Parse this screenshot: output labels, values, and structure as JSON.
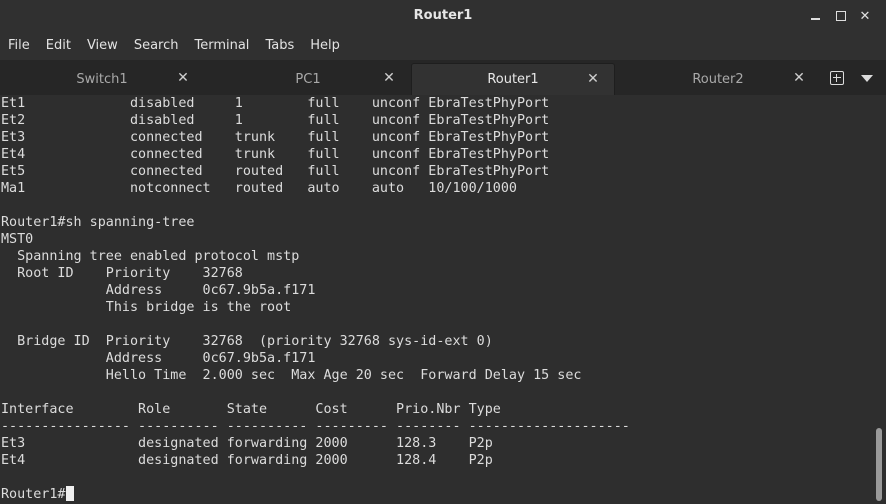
{
  "window": {
    "title": "Router1",
    "minimize_glyph": "–",
    "close_glyph": "✕"
  },
  "menu": {
    "items": [
      {
        "label": "File"
      },
      {
        "label": "Edit"
      },
      {
        "label": "View"
      },
      {
        "label": "Search"
      },
      {
        "label": "Terminal"
      },
      {
        "label": "Tabs"
      },
      {
        "label": "Help"
      }
    ]
  },
  "tabs": [
    {
      "label": "Switch1",
      "active": false
    },
    {
      "label": "PC1",
      "active": false
    },
    {
      "label": "Router1",
      "active": true
    },
    {
      "label": "Router2",
      "active": false
    }
  ],
  "tab_close_glyph": "✕",
  "terminal": {
    "lines": [
      "Et1             disabled     1        full    unconf EbraTestPhyPort",
      "Et2             disabled     1        full    unconf EbraTestPhyPort",
      "Et3             connected    trunk    full    unconf EbraTestPhyPort",
      "Et4             connected    trunk    full    unconf EbraTestPhyPort",
      "Et5             connected    routed   full    unconf EbraTestPhyPort",
      "Ma1             notconnect   routed   auto    auto   10/100/1000",
      "",
      "Router1#sh spanning-tree",
      "MST0",
      "  Spanning tree enabled protocol mstp",
      "  Root ID    Priority    32768",
      "             Address     0c67.9b5a.f171",
      "             This bridge is the root",
      "",
      "  Bridge ID  Priority    32768  (priority 32768 sys-id-ext 0)",
      "             Address     0c67.9b5a.f171",
      "             Hello Time  2.000 sec  Max Age 20 sec  Forward Delay 15 sec",
      "",
      "Interface        Role       State      Cost      Prio.Nbr Type",
      "---------------- ---------- ---------- --------- -------- --------------------",
      "Et3              designated forwarding 2000      128.3    P2p",
      "Et4              designated forwarding 2000      128.4    P2p",
      ""
    ],
    "prompt": "Router1#"
  },
  "colors": {
    "terminal_bg": "#2e2e2e",
    "terminal_fg": "#dcdcdc",
    "chrome_bg": "#303030",
    "active_tab_bg": "#323232"
  }
}
